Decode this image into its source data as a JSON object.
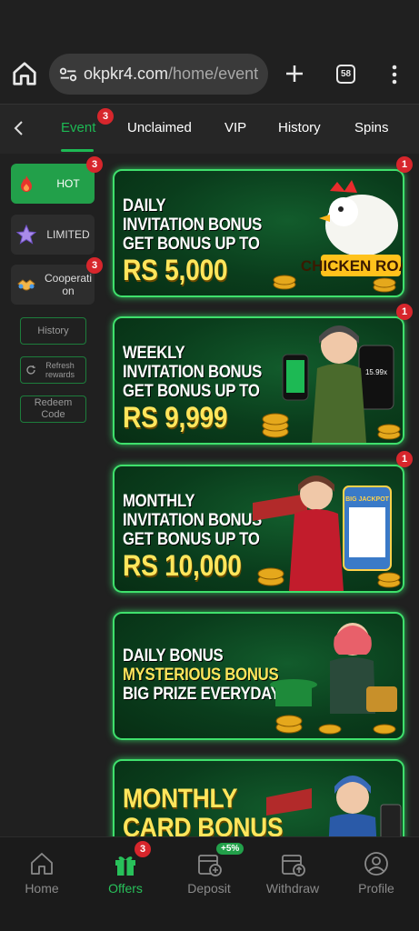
{
  "browser": {
    "url_host": "okpkr4.com",
    "url_path": "/home/event",
    "tab_count": "58"
  },
  "tabs": [
    {
      "label": "Event",
      "badge": "3"
    },
    {
      "label": "Unclaimed"
    },
    {
      "label": "VIP"
    },
    {
      "label": "History"
    },
    {
      "label": "Spins"
    }
  ],
  "sidebar": {
    "hot": {
      "label": "HOT",
      "badge": "3"
    },
    "limited": {
      "label": "LIMITED"
    },
    "cooperation": {
      "label": "Cooperati on",
      "badge": "3"
    },
    "history": "History",
    "refresh": "Refresh rewards",
    "redeem": "Redeem Code"
  },
  "banners": [
    {
      "lines": [
        "DAILY",
        "INVITATION BONUS",
        "GET BONUS UP TO"
      ],
      "amount": "RS 5,000",
      "badge": "1",
      "art_text": "CHICKEN ROAD"
    },
    {
      "lines": [
        "WEEKLY",
        "INVITATION BONUS",
        "GET BONUS UP TO"
      ],
      "amount": "RS 9,999",
      "badge": "1",
      "art_text": "15.99x"
    },
    {
      "lines": [
        "MONTHLY",
        "INVITATION BONUS",
        "GET BONUS UP TO"
      ],
      "amount": "RS 10,000",
      "badge": "1",
      "art_text": "BIG JACKPOT"
    },
    {
      "lines": [
        "DAILY BONUS",
        "MYSTERIOUS BONUS",
        "BIG PRIZE EVERYDAY"
      ]
    },
    {
      "lines": [
        "MONTHLY",
        "CARD BONUS"
      ]
    }
  ],
  "bottom_nav": [
    {
      "label": "Home"
    },
    {
      "label": "Offers",
      "badge": "3"
    },
    {
      "label": "Deposit",
      "tag": "+5%"
    },
    {
      "label": "Withdraw"
    },
    {
      "label": "Profile"
    }
  ],
  "colors": {
    "accent": "#1db954",
    "badge": "#d7262c",
    "banner_border": "#3fe06c",
    "amount": "#ffe65c"
  }
}
